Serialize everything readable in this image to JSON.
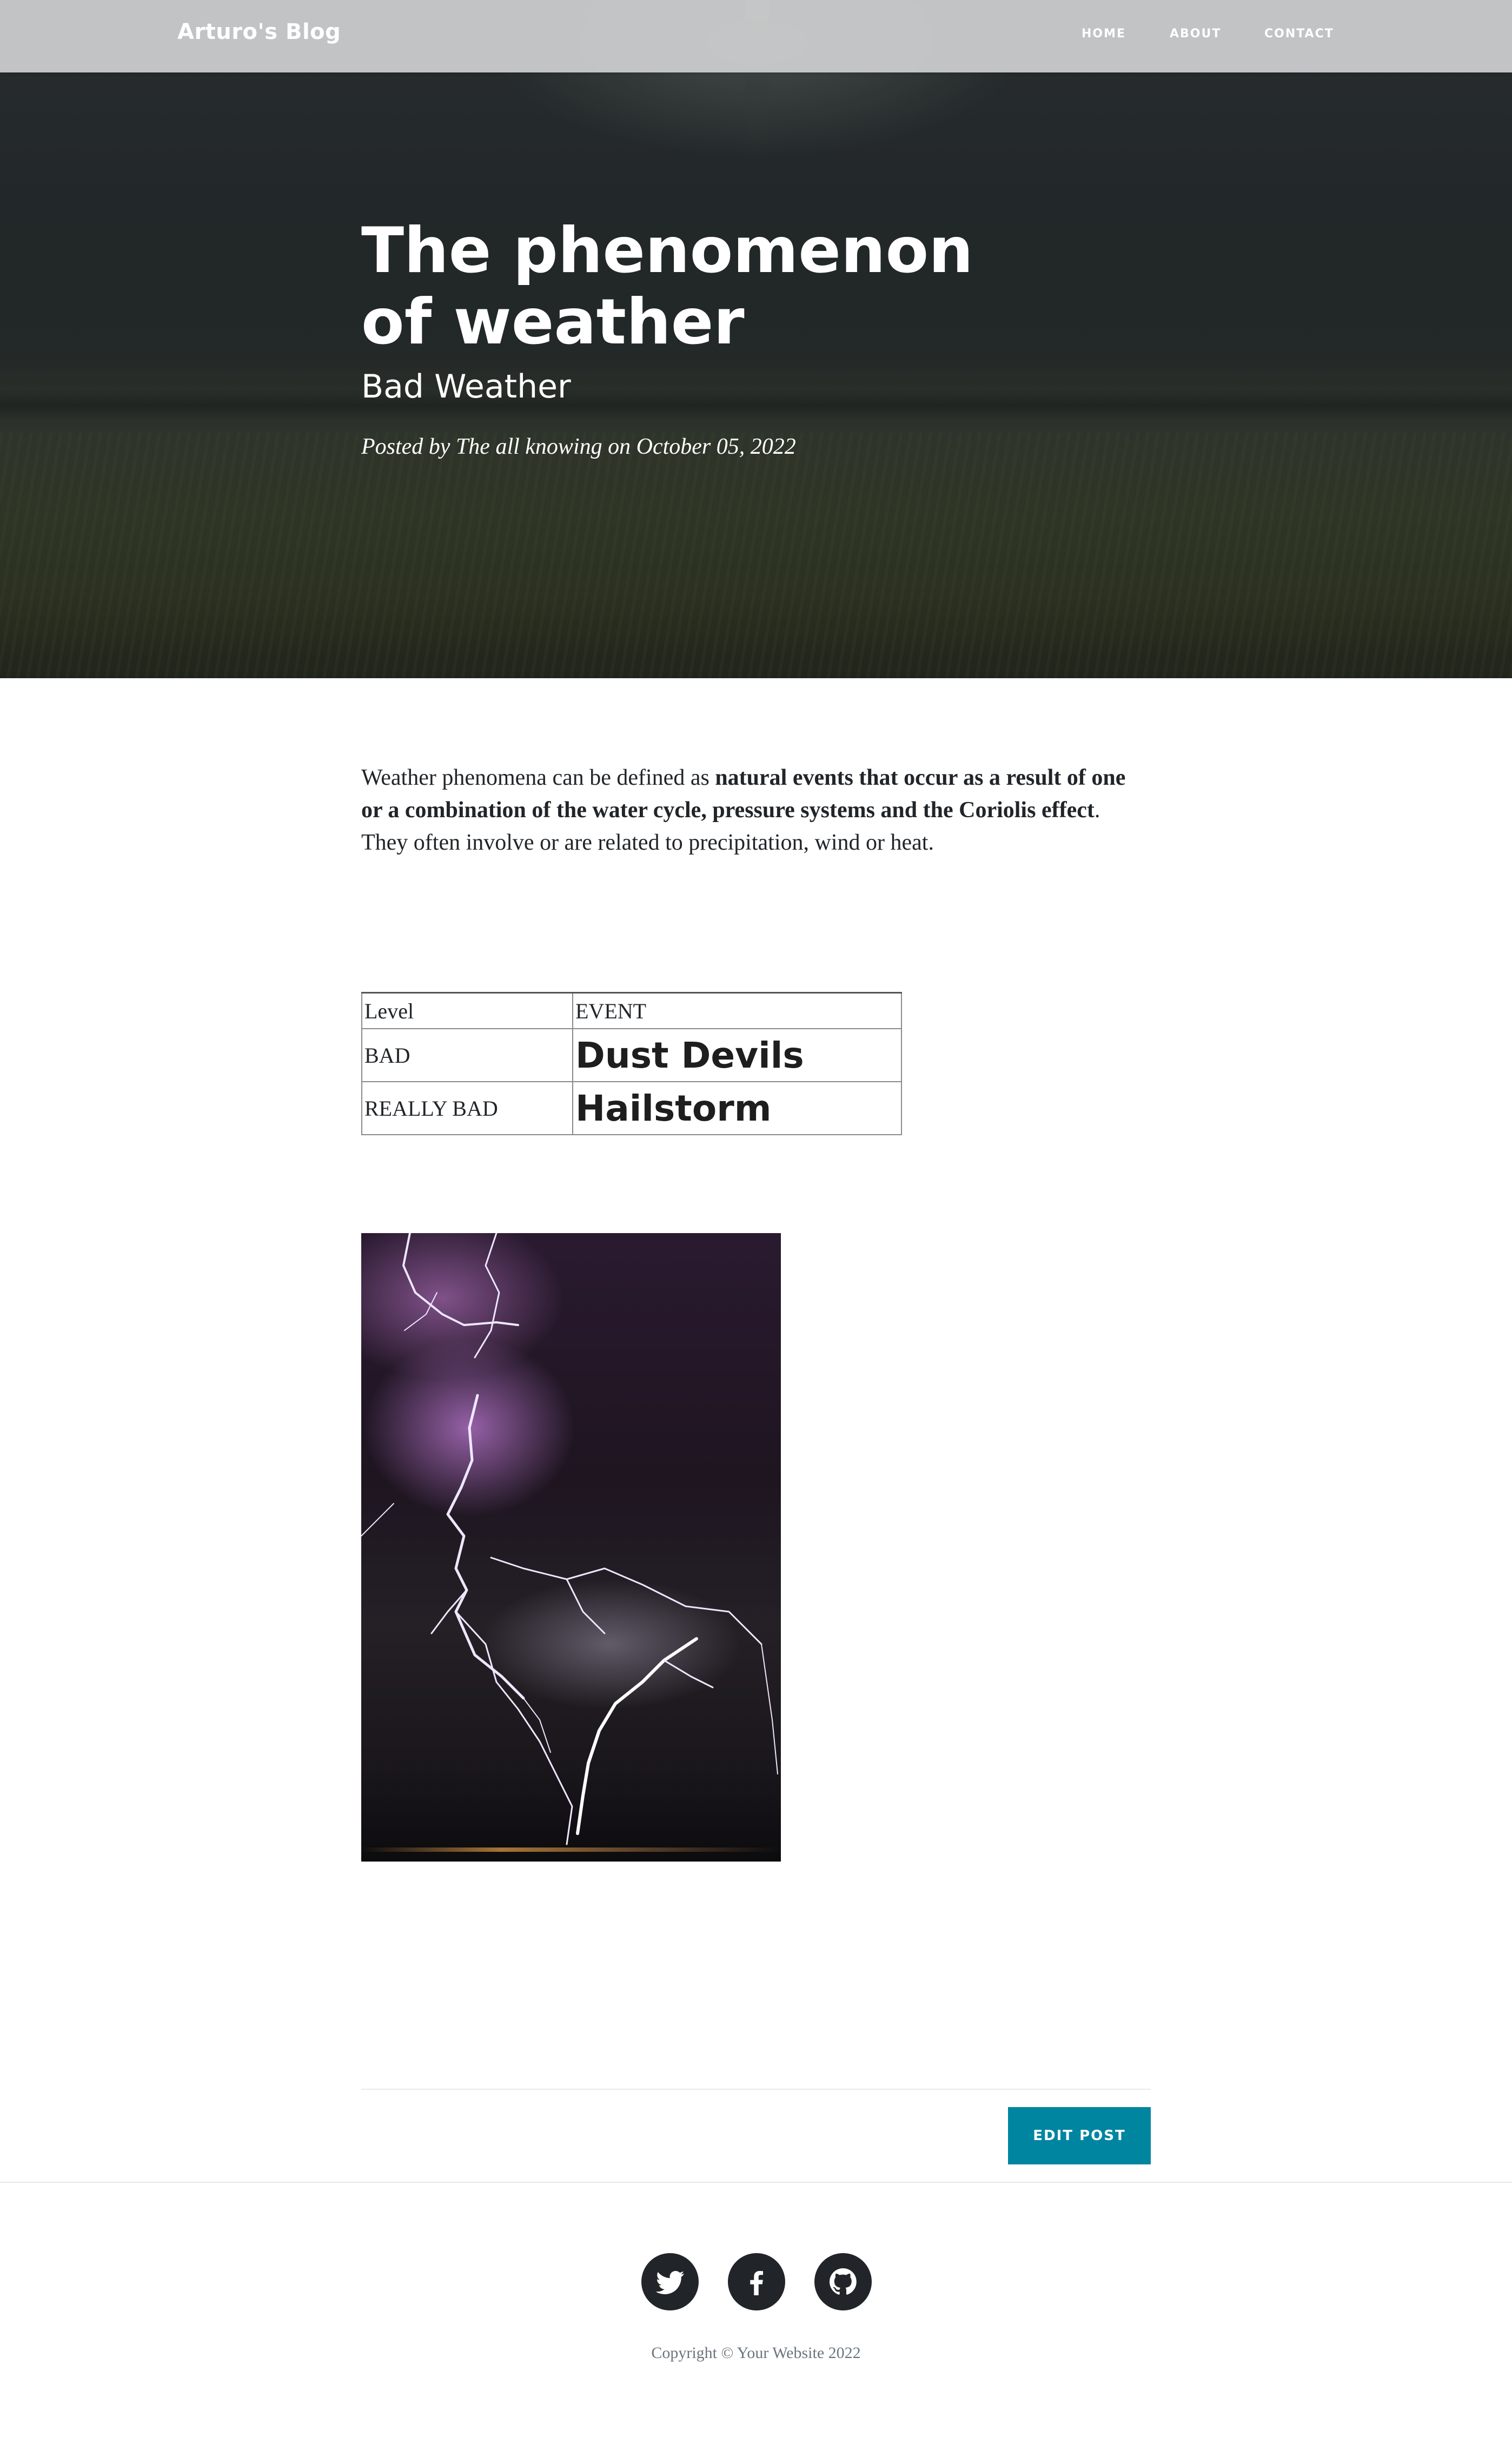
{
  "navbar": {
    "brand": "Arturo's Blog",
    "links": [
      "HOME",
      "ABOUT",
      "CONTACT"
    ]
  },
  "hero": {
    "title": "The phenomenon of weather",
    "subtitle": "Bad Weather",
    "meta_prefix": "Posted by",
    "author": "The all knowing",
    "meta_on": "on",
    "date": "October 05, 2022"
  },
  "article": {
    "intro_lead": "Weather phenomena can be defined as ",
    "intro_bold": "natural events that occur as a result of one or a combination of the water cycle, pressure systems and the Coriolis effect",
    "intro_tail": ". They often involve or are related to precipitation, wind or heat.",
    "table": {
      "headers": [
        "Level",
        "EVENT"
      ],
      "rows": [
        {
          "level": "BAD",
          "event": "Dust Devils"
        },
        {
          "level": "REALLY BAD",
          "event": "Hailstorm"
        }
      ]
    },
    "edit_button": "EDIT POST"
  },
  "footer": {
    "social_icons": [
      "twitter-icon",
      "facebook-icon",
      "github-icon"
    ],
    "copyright": "Copyright © Your Website 2022"
  },
  "colors": {
    "accent": "#0085a1",
    "text": "#212529",
    "muted": "#6c757d",
    "social_bg": "#212529"
  }
}
